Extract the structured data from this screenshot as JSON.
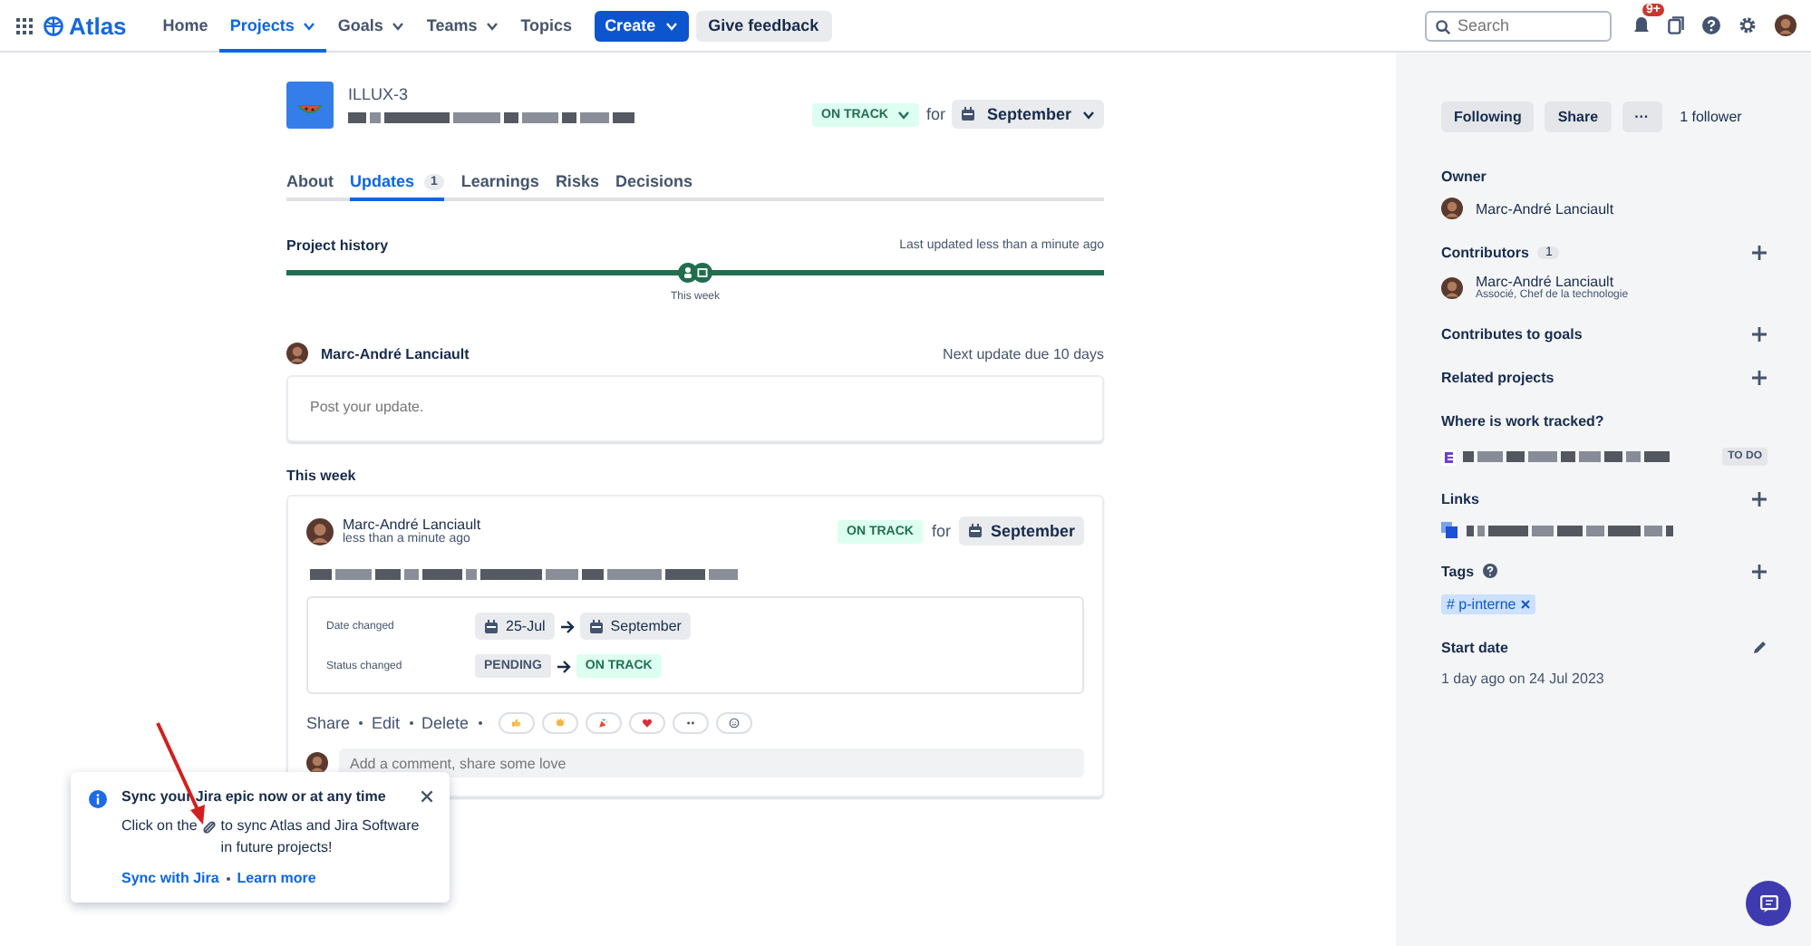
{
  "nav": {
    "logo": "Atlas",
    "items": [
      {
        "label": "Home",
        "selected": false,
        "dropdown": false
      },
      {
        "label": "Projects",
        "selected": true,
        "dropdown": true
      },
      {
        "label": "Goals",
        "selected": false,
        "dropdown": true
      },
      {
        "label": "Teams",
        "selected": false,
        "dropdown": true
      },
      {
        "label": "Topics",
        "selected": false,
        "dropdown": false
      }
    ],
    "create": "Create",
    "feedback": "Give feedback",
    "search": {
      "placeholder": "Search"
    },
    "badge": "9+"
  },
  "project": {
    "key": "ILLUX-3",
    "status": "ON TRACK",
    "for": "for",
    "target": "September"
  },
  "tabs": [
    {
      "label": "About",
      "selected": false
    },
    {
      "label": "Updates",
      "count": "1",
      "selected": true
    },
    {
      "label": "Learnings",
      "selected": false
    },
    {
      "label": "Risks",
      "selected": false
    },
    {
      "label": "Decisions",
      "selected": false
    }
  ],
  "history": {
    "title": "Project history",
    "last_updated": "Last updated less than a minute ago",
    "marker": "This week"
  },
  "composer": {
    "author": "Marc-André Lanciault",
    "due": "Next update due 10 days",
    "placeholder": "Post your update."
  },
  "week_heading": "This week",
  "update": {
    "author": "Marc-André Lanciault",
    "time": "less than a minute ago",
    "status": "ON TRACK",
    "for": "for",
    "target": "September",
    "changes": [
      {
        "label": "Date changed",
        "kind": "date",
        "from": "25-Jul",
        "to": "September"
      },
      {
        "label": "Status changed",
        "kind": "status",
        "from": "PENDING",
        "to": "ON TRACK"
      }
    ],
    "actions": [
      "Share",
      "Edit",
      "Delete"
    ],
    "reactions": [
      {
        "kind": "thumbs-up"
      },
      {
        "kind": "clap"
      },
      {
        "kind": "party"
      },
      {
        "kind": "heart"
      },
      {
        "kind": "eyes"
      },
      {
        "kind": "add"
      }
    ],
    "comment_placeholder": "Add a comment, share some love"
  },
  "sidebar": {
    "buttons": [
      "Following",
      "Share"
    ],
    "more": "···",
    "followers": "1 follower",
    "sections": [
      {
        "kind": "person",
        "title": "Owner",
        "addable": false,
        "name": "Marc-André Lanciault"
      },
      {
        "kind": "person",
        "title": "Contributors",
        "count": "1",
        "addable": true,
        "name": "Marc-André Lanciault",
        "role": "Associé, Chef de la technologie"
      },
      {
        "kind": "empty",
        "title": "Contributes to goals",
        "addable": true
      },
      {
        "kind": "empty",
        "title": "Related projects",
        "addable": true
      },
      {
        "kind": "work",
        "title": "Where is work tracked?",
        "addable": false,
        "status": "TO DO"
      },
      {
        "kind": "link",
        "title": "Links",
        "addable": true
      },
      {
        "kind": "tags",
        "title": "Tags",
        "help": true,
        "addable": true,
        "tags": [
          "# p-interne"
        ]
      },
      {
        "kind": "date",
        "title": "Start date",
        "addable": false,
        "editable": true,
        "value": "1 day ago on 24 Jul 2023"
      }
    ]
  },
  "toast": {
    "title": "Sync your Jira epic now or at any time",
    "body_before": "Click on the",
    "body_after": "to sync Atlas and Jira Software in future projects!",
    "links": [
      "Sync with Jira",
      "Learn more"
    ]
  }
}
